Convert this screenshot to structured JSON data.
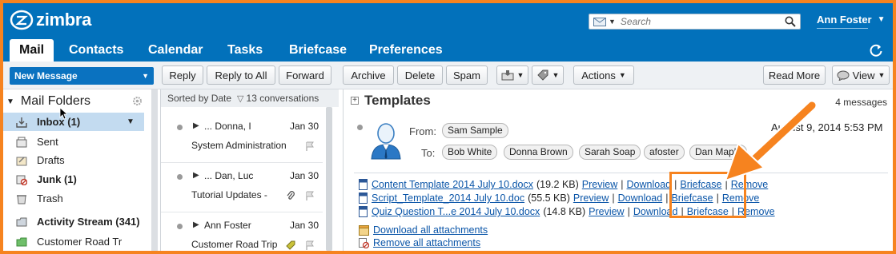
{
  "app": {
    "name": "zimbra",
    "user": "Ann Foster"
  },
  "search": {
    "placeholder": "Search"
  },
  "tabs": [
    {
      "label": "Mail",
      "active": true
    },
    {
      "label": "Contacts"
    },
    {
      "label": "Calendar"
    },
    {
      "label": "Tasks"
    },
    {
      "label": "Briefcase"
    },
    {
      "label": "Preferences"
    }
  ],
  "toolbar": {
    "new_message": "New Message",
    "reply": "Reply",
    "reply_all": "Reply to All",
    "forward": "Forward",
    "archive": "Archive",
    "delete": "Delete",
    "spam": "Spam",
    "actions": "Actions",
    "read_more": "Read More",
    "view": "View"
  },
  "sidebar": {
    "title": "Mail Folders",
    "folders": [
      {
        "label": "Inbox (1)",
        "icon": "inbox-icon",
        "bold": true,
        "selected": true
      },
      {
        "label": "Sent",
        "icon": "sent-icon"
      },
      {
        "label": "Drafts",
        "icon": "drafts-icon"
      },
      {
        "label": "Junk (1)",
        "icon": "junk-icon",
        "bold": true
      },
      {
        "label": "Trash",
        "icon": "trash-icon"
      },
      {
        "label": "Activity Stream (341)",
        "icon": "activity-icon",
        "bold": true
      },
      {
        "label": "Customer Road Tr",
        "icon": "folder-icon"
      }
    ]
  },
  "list": {
    "sort_label": "Sorted by Date",
    "count": "13 conversations",
    "items": [
      {
        "from": "... Donna, I",
        "date": "Jan 30",
        "subject": "System Administration"
      },
      {
        "from": "... Dan, Luc",
        "date": "Jan 30",
        "subject": "Tutorial Updates -",
        "attachment": true
      },
      {
        "from": "Ann Foster",
        "date": "Jan 30",
        "subject": "Customer Road Trip",
        "tag": true
      }
    ]
  },
  "reading": {
    "title": "Templates",
    "count": "4 messages",
    "from_label": "From:",
    "to_label": "To:",
    "from": "Sam Sample",
    "to": [
      "Bob White",
      "Donna Brown",
      "Sarah Soap",
      "afoster",
      "Dan Maple"
    ],
    "date": "August 9, 2014 5:53 PM",
    "attachments": [
      {
        "name": "Content Template 2014 July 10.docx",
        "size": "(19.2 KB)"
      },
      {
        "name": "Script_Template_2014 July 10.doc",
        "size": "(55.5 KB)"
      },
      {
        "name": "Quiz Question T...e 2014 July 10.docx",
        "size": "(14.8 KB)"
      }
    ],
    "actions": {
      "preview": "Preview",
      "download": "Download",
      "briefcase": "Briefcase",
      "remove": "Remove"
    },
    "download_all": "Download all attachments",
    "remove_all": "Remove all attachments"
  },
  "colors": {
    "header": "#0271bb",
    "accent": "#f6831f",
    "link": "#0a55a8"
  }
}
